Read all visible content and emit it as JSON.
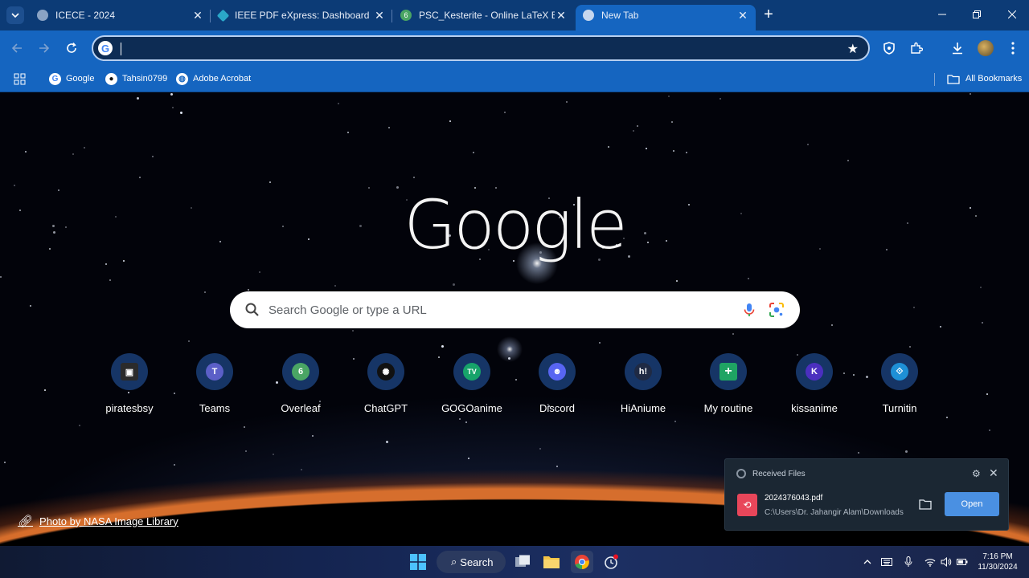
{
  "browser": {
    "tabs": [
      {
        "title": "ICECE - 2024",
        "favicon": "globe-icon",
        "active": false
      },
      {
        "title": "IEEE PDF eXpress: Dashboard",
        "favicon": "ieee-icon",
        "active": false
      },
      {
        "title": "PSC_Kesterite - Online LaTeX Edito",
        "favicon": "overleaf-icon",
        "active": false
      },
      {
        "title": "New Tab",
        "favicon": "chrome-icon",
        "active": true
      }
    ],
    "new_tab_symbol": "+",
    "omnibox": {
      "value": "",
      "placeholder": ""
    },
    "bookmarks": [
      {
        "label": "Google",
        "icon": "google-icon"
      },
      {
        "label": "Tahsin0799",
        "icon": "github-icon"
      },
      {
        "label": "Adobe Acrobat",
        "icon": "globe-icon"
      }
    ],
    "all_bookmarks_label": "All Bookmarks"
  },
  "newtab": {
    "logo": "Google",
    "search_placeholder": "Search Google or type a URL",
    "shortcuts": [
      {
        "label": "piratesbsy",
        "icon": "piratesbsy-icon",
        "color": "#2b2b2b",
        "glyph": "▣"
      },
      {
        "label": "Teams",
        "icon": "teams-icon",
        "color": "#5b5fc7",
        "glyph": "T"
      },
      {
        "label": "Overleaf",
        "icon": "overleaf-icon",
        "color": "#4aa564",
        "glyph": "6"
      },
      {
        "label": "ChatGPT",
        "icon": "chatgpt-icon",
        "color": "#111111",
        "glyph": "✺"
      },
      {
        "label": "GOGOanime",
        "icon": "gogoanime-icon",
        "color": "#17a36a",
        "glyph": "TV"
      },
      {
        "label": "Discord",
        "icon": "discord-icon",
        "color": "#5865f2",
        "glyph": "☻"
      },
      {
        "label": "HiAniume",
        "icon": "hianime-icon",
        "color": "#1f2a44",
        "glyph": "h!"
      },
      {
        "label": "My routine",
        "icon": "sheets-icon",
        "color": "#1fa463",
        "glyph": "+"
      },
      {
        "label": "kissanime",
        "icon": "kissanime-icon",
        "color": "#4b2fbf",
        "glyph": "K"
      },
      {
        "label": "Turnitin",
        "icon": "turnitin-icon",
        "color": "#1e90d6",
        "glyph": "⟐"
      }
    ],
    "photo_credit": "Photo by NASA Image Library"
  },
  "notification": {
    "title": "Received Files",
    "file_name": "2024376043.pdf",
    "file_path": "C:\\Users\\Dr. Jahangir Alam\\Downloads",
    "open_label": "Open"
  },
  "taskbar": {
    "search_label": "Search",
    "time": "7:16 PM",
    "date": "11/30/2024"
  },
  "colors": {
    "accent": "#1565c0",
    "tab_strip": "#0c3b76",
    "notification_button": "#4a90e2"
  }
}
